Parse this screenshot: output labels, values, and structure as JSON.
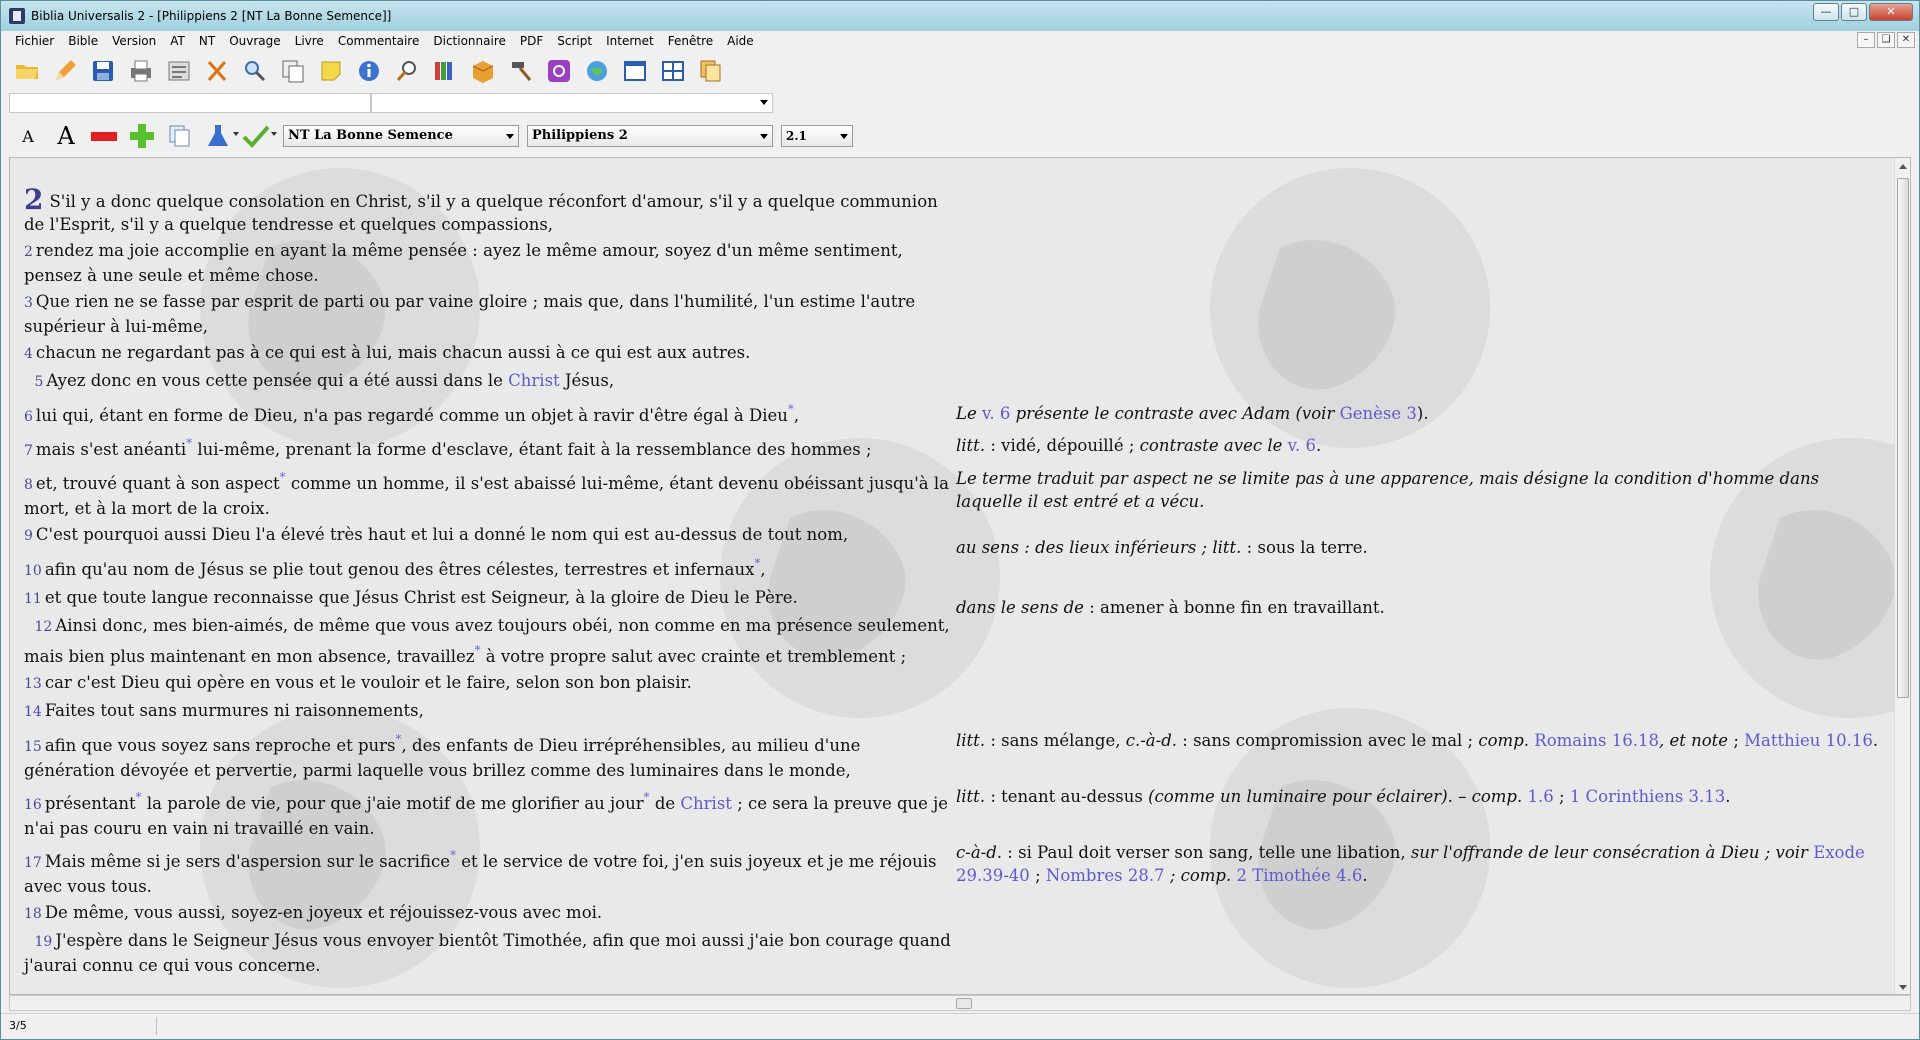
{
  "window": {
    "title": "Biblia Universalis 2 - [Philippiens 2 [NT La Bonne Semence]]"
  },
  "menu": [
    "Fichier",
    "Bible",
    "Version",
    "AT",
    "NT",
    "Ouvrage",
    "Livre",
    "Commentaire",
    "Dictionnaire",
    "PDF",
    "Script",
    "Internet",
    "Fenêtre",
    "Aide"
  ],
  "toolbar": {
    "icons": [
      "open-folder-icon",
      "pencil-icon",
      "save-icon",
      "print-icon",
      "properties-icon",
      "cut-icon",
      "search-icon",
      "copy-pages-icon",
      "note-icon",
      "info-icon",
      "zoom-icon",
      "library-icon",
      "package-icon",
      "hammer-icon",
      "email-icon",
      "globe-icon",
      "window-icon",
      "tile-icon",
      "stack-icon"
    ]
  },
  "search": {
    "value": "",
    "combo_value": ""
  },
  "selectors": {
    "version": "NT La Bonne Semence",
    "book": "Philippiens 2",
    "verse": "2.1"
  },
  "chapter": "2",
  "verses": [
    {
      "n": "",
      "text": "S'il y a donc quelque consolation en Christ, s'il y a quelque réconfort d'amour, s'il y a quelque communion de l'Esprit, s'il y a quelque tendresse et quelques compassions,"
    },
    {
      "n": "2",
      "text": "rendez ma joie accomplie en ayant la même pensée : ayez le même amour, soyez d'un même sentiment, pensez à une seule et même chose."
    },
    {
      "n": "3",
      "text": "Que rien ne se fasse par esprit de parti ou par vaine gloire ; mais que, dans l'humilité, l'un estime l'autre supérieur à lui-même,"
    },
    {
      "n": "4",
      "text": "chacun ne regardant pas à ce qui est à lui, mais chacun aussi à ce qui est aux autres."
    },
    {
      "n": "5",
      "text": "Ayez donc en vous cette pensée qui a été aussi dans le",
      "link": "Christ",
      "after": "Jésus,"
    },
    {
      "n": "6",
      "text": "lui qui, étant en forme de Dieu, n'a pas regardé comme un objet à ravir d'être égal à Dieu",
      "star": "*",
      "after": ","
    },
    {
      "n": "7",
      "text": "mais s'est anéanti",
      "star": "*",
      "after": "lui-même, prenant la forme d'esclave, étant fait à la ressemblance des hommes ;"
    },
    {
      "n": "8",
      "text": "et, trouvé quant à son aspect",
      "star": "*",
      "after": "comme un homme, il s'est abaissé lui-même, étant devenu obéissant jusqu'à la mort, et à la mort de la croix."
    },
    {
      "n": "9",
      "text": "C'est pourquoi aussi Dieu l'a élevé très haut et lui a donné le nom qui est au-dessus de tout nom,"
    },
    {
      "n": "10",
      "text": "afin qu'au nom de Jésus se plie tout genou des êtres célestes, terrestres et infernaux",
      "star": "*",
      "after": ","
    },
    {
      "n": "11",
      "text": "et que toute langue reconnaisse que Jésus Christ est Seigneur, à la gloire de Dieu le Père."
    },
    {
      "n": "12",
      "text": "Ainsi donc, mes bien-aimés, de même que vous avez toujours obéi, non comme en ma présence seulement, mais bien plus maintenant en mon absence, travaillez",
      "star": "*",
      "after": "à votre propre salut avec crainte et tremblement ;"
    },
    {
      "n": "13",
      "text": "car c'est Dieu qui opère en vous et le vouloir et le faire, selon son bon plaisir."
    },
    {
      "n": "14",
      "text": "Faites tout sans murmures ni raisonnements,"
    },
    {
      "n": "15",
      "text": "afin que vous soyez sans reproche et purs",
      "star": "*",
      "after": ", des enfants de Dieu irrépréhensibles, au milieu d'une génération dévoyée et pervertie, parmi laquelle vous brillez comme des luminaires dans le monde,"
    },
    {
      "n": "16",
      "text": "présentant",
      "star": "*",
      "after": "la parole de vie, pour que j'aie motif de me glorifier au jour",
      "star2": "*",
      "mid": "de",
      "link": "Christ",
      "tail": "; ce sera la preuve que je n'ai pas couru en vain ni travaillé en vain."
    },
    {
      "n": "17",
      "text": "Mais même si je sers d'aspersion sur le sacrifice",
      "star": "*",
      "after": "et le service de votre foi, j'en suis joyeux et je me réjouis avec vous tous."
    },
    {
      "n": "18",
      "text": "De même, vous aussi, soyez-en joyeux et réjouissez-vous avec moi."
    },
    {
      "n": "19",
      "text": "J'espère dans le Seigneur Jésus vous envoyer bientôt Timothée, afin que moi aussi j'aie bon courage quand j'aurai connu ce qui vous concerne."
    }
  ],
  "notes": {
    "n6": {
      "a": "Le",
      "ref1": "v. 6",
      "b": "présente le contraste avec Adam (voir",
      "ref2": "Genèse 3",
      "c": ")."
    },
    "n7": {
      "a": "litt.",
      "b": ": vidé, dépouillé ;",
      "c": "contraste avec le",
      "ref": "v. 6",
      "d": "."
    },
    "n8": {
      "a": "Le terme traduit par aspect ne se limite pas à une apparence, mais désigne la condition d'homme dans laquelle il est entré et a vécu."
    },
    "n10": {
      "a": "au sens : des lieux inférieurs ; litt.",
      "b": ": sous la terre."
    },
    "n12": {
      "a": "dans le sens de",
      "b": ": amener à bonne fin en travaillant."
    },
    "n15": {
      "a": "litt.",
      "b": ": sans mélange,",
      "c": "c.-à-d.",
      "d": ": sans compromission avec le mal ;",
      "e": "comp.",
      "ref1": "Romains 16.18",
      "f": ", et note",
      "g": ";",
      "ref2": "Matthieu 10.16",
      "h": "."
    },
    "n16": {
      "a": "litt.",
      "b": ": tenant au-dessus",
      "c": "(comme un luminaire pour éclairer). – comp.",
      "ref1": "1.6",
      "d": ";",
      "ref2": "1 Corinthiens 3.13",
      "e": "."
    },
    "n17": {
      "a": "c-à-d.",
      "b": ": si Paul doit verser son sang, telle une libation,",
      "c": "sur l'offrande de leur consécration à Dieu ; voir",
      "ref1": "Exode 29.39-40",
      "d": ";",
      "ref2": "Nombres 28.7",
      "e": "; comp.",
      "ref3": "2 Timothée 4.6",
      "f": "."
    }
  },
  "status": {
    "page": "3/5"
  }
}
